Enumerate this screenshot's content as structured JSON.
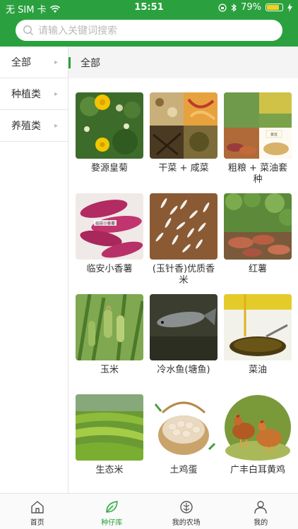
{
  "status_bar": {
    "carrier": "无 SIM 卡",
    "time": "15:51",
    "battery": "79%",
    "battery_level": 0.79
  },
  "search": {
    "placeholder": "请输入关键词搜索",
    "icon": "search-icon"
  },
  "sidebar": {
    "items": [
      {
        "label": "全部"
      },
      {
        "label": "种植类"
      },
      {
        "label": "养殖类"
      }
    ]
  },
  "category_header": {
    "label": "全部"
  },
  "products": [
    {
      "name": "婺源皇菊"
    },
    {
      "name": "干菜 + 咸菜"
    },
    {
      "name": "粗粮 + 菜油套种"
    },
    {
      "name": "临安小香薯"
    },
    {
      "name": "(玉针香)优质香米"
    },
    {
      "name": "红薯"
    },
    {
      "name": "玉米"
    },
    {
      "name": "冷水鱼(塘鱼)"
    },
    {
      "name": "菜油"
    },
    {
      "name": "生态米"
    },
    {
      "name": "土鸡蛋"
    },
    {
      "name": "广丰白耳黄鸡"
    }
  ],
  "thumb_overlays": {
    "sweet_potato_caption": "临安小香薯",
    "grain_caption": "黄豆"
  },
  "tabbar": {
    "tabs": [
      {
        "label": "首页",
        "icon": "home-icon"
      },
      {
        "label": "种仔库",
        "icon": "leaf-icon"
      },
      {
        "label": "我的农场",
        "icon": "farm-icon"
      },
      {
        "label": "我的",
        "icon": "person-icon"
      }
    ],
    "active_index": 1
  },
  "colors": {
    "brand": "#2aa13e",
    "sidebar_border": "#e3e3e3",
    "category_bg": "#f4f4f4"
  }
}
